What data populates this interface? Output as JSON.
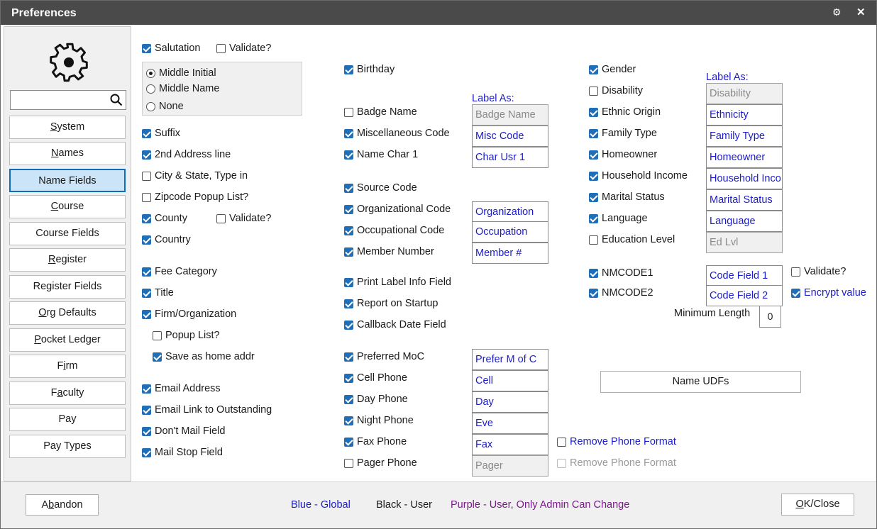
{
  "window": {
    "title": "Preferences"
  },
  "sidebar": {
    "search_placeholder": "",
    "items": [
      {
        "label": "System",
        "active": false
      },
      {
        "label": "Names",
        "active": false
      },
      {
        "label": "Name Fields",
        "active": true
      },
      {
        "label": "Course",
        "active": false
      },
      {
        "label": "Course Fields",
        "active": false
      },
      {
        "label": "Register",
        "active": false
      },
      {
        "label": "Register Fields",
        "active": false
      },
      {
        "label": "Org Defaults",
        "active": false
      },
      {
        "label": "Pocket Ledger",
        "active": false
      },
      {
        "label": "Firm",
        "active": false
      },
      {
        "label": "Faculty",
        "active": false
      },
      {
        "label": "Pay",
        "active": false
      },
      {
        "label": "Pay Types",
        "active": false
      }
    ]
  },
  "col1": {
    "salutation": "Salutation",
    "validate1": "Validate?",
    "radio_middle_initial": "Middle Initial",
    "radio_middle_name": "Middle Name",
    "radio_none": "None",
    "suffix": "Suffix",
    "address2": "2nd Address line",
    "city_state": "City & State, Type in",
    "zipcode": "Zipcode Popup List?",
    "county": "County",
    "validate2": "Validate?",
    "country": "Country",
    "fee_category": "Fee Category",
    "title": "Title",
    "firm": "Firm/Organization",
    "popup_list": "Popup List?",
    "save_home": "Save as home addr",
    "email": "Email Address",
    "email_link": "Email Link to Outstanding",
    "dont_mail": "Don't Mail Field",
    "mail_stop": "Mail Stop Field"
  },
  "col2": {
    "label_as": "Label As:",
    "birthday": "Birthday",
    "badge_name": "Badge Name",
    "badge_name_val": "Badge Name",
    "misc_code": "Miscellaneous Code",
    "misc_code_val": "Misc Code",
    "name_char1": "Name Char 1",
    "name_char1_val": "Char Usr 1",
    "source_code": "Source Code",
    "org_code": "Organizational Code",
    "org_code_val": "Organization",
    "occ_code": "Occupational Code",
    "occ_code_val": "Occupation",
    "member_number": "Member Number",
    "member_number_val": "Member #",
    "print_label": "Print Label Info Field",
    "report_startup": "Report on Startup",
    "callback": "Callback Date Field",
    "preferred_moc": "Preferred MoC",
    "preferred_moc_val": "Prefer M of C",
    "cell_phone": "Cell Phone",
    "cell_phone_val": "Cell",
    "day_phone": "Day Phone",
    "day_phone_val": "Day",
    "night_phone": "Night Phone",
    "night_phone_val": "Eve",
    "fax_phone": "Fax Phone",
    "fax_phone_val": "Fax",
    "pager_phone": "Pager Phone",
    "pager_phone_val": "Pager",
    "remove_format1": "Remove Phone Format",
    "remove_format2": "Remove Phone Format"
  },
  "col3": {
    "label_as": "Label As:",
    "gender": "Gender",
    "disability": "Disability",
    "disability_val": "Disability",
    "ethnic": "Ethnic Origin",
    "ethnic_val": "Ethnicity",
    "family_type": "Family Type",
    "family_type_val": "Family Type",
    "homeowner": "Homeowner",
    "homeowner_val": "Homeowner",
    "household_income": "Household Income",
    "household_income_val": "Household Inco",
    "marital": "Marital Status",
    "marital_val": "Marital Status",
    "language": "Language",
    "language_val": "Language",
    "education": "Education Level",
    "education_val": "Ed Lvl",
    "nmcode1": "NMCODE1",
    "nmcode1_val": "Code Field 1",
    "nmcode2": "NMCODE2",
    "nmcode2_val": "Code Field 2",
    "validate3": "Validate?",
    "encrypt": "Encrypt value",
    "min_length_label": "Minimum Length",
    "min_length_val": "0",
    "name_udfs": "Name UDFs"
  },
  "footer": {
    "abandon": "Abandon",
    "legend_blue": "Blue - Global",
    "legend_black": "Black - User",
    "legend_purple": "Purple - User, Only Admin Can Change",
    "ok_close": "OK/Close"
  },
  "colors": {
    "accent": "#1f6fb8",
    "global_blue": "#1c1cc8",
    "admin_purple": "#7a1a8a",
    "titlebar": "#4a4a4a"
  }
}
